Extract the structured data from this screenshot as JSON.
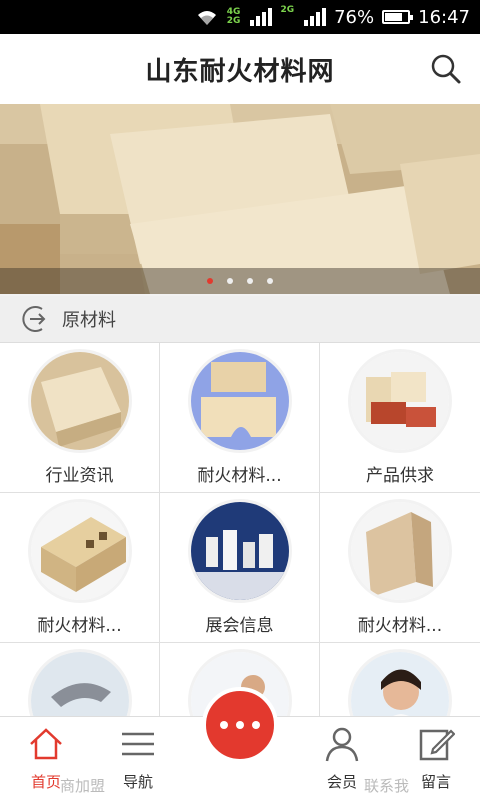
{
  "status": {
    "network_top": "4G",
    "network_bottom": "2G",
    "network2": "2G",
    "battery": "76%",
    "time": "16:47",
    "battery_level": 0.76
  },
  "header": {
    "title": "山东耐火材料网",
    "search_icon": "search-icon"
  },
  "banner": {
    "dots_count": 4,
    "active_dot": 0
  },
  "section": {
    "label": "原材料",
    "icon": "enter-circle-icon"
  },
  "grid": [
    {
      "label": "行业资讯"
    },
    {
      "label": "耐火材料..."
    },
    {
      "label": "产品供求"
    },
    {
      "label": "耐火材料..."
    },
    {
      "label": "展会信息"
    },
    {
      "label": "耐火材料..."
    },
    {
      "label": ""
    },
    {
      "label": ""
    },
    {
      "label": ""
    }
  ],
  "nav": {
    "home": "首页",
    "join": "商加盟",
    "navigate": "导航",
    "member": "会员",
    "contact": "联系我",
    "message": "留言",
    "active_color": "#e23a2e"
  }
}
